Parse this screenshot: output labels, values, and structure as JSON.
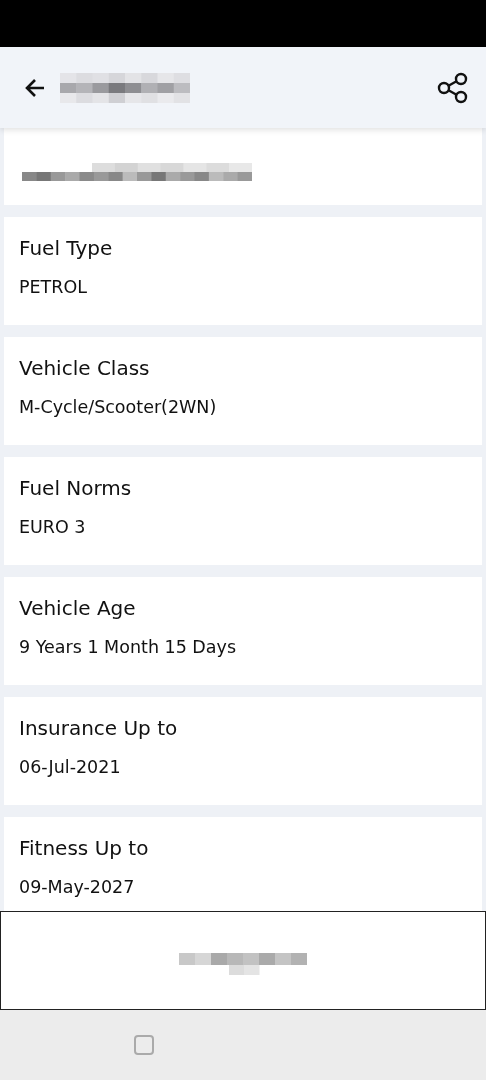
{
  "fields": [
    {
      "label": "Fuel Type",
      "value": "PETROL"
    },
    {
      "label": "Vehicle Class",
      "value": "M-Cycle/Scooter(2WN)"
    },
    {
      "label": "Fuel Norms",
      "value": "EURO 3"
    },
    {
      "label": "Vehicle Age",
      "value": "9 Years 1 Month 15 Days"
    },
    {
      "label": "Insurance Up to",
      "value": "06-Jul-2021"
    },
    {
      "label": "Fitness Up to",
      "value": "09-May-2027"
    }
  ]
}
